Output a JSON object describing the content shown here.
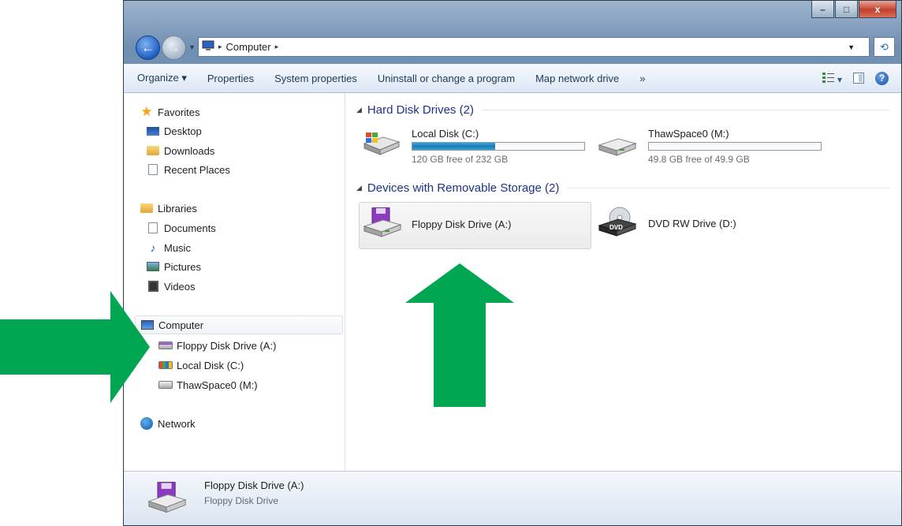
{
  "window": {
    "controls": {
      "minimize": "–",
      "maximize": "□",
      "close": "x"
    }
  },
  "address": {
    "back_icon": "left-arrow",
    "forward_icon": "right-arrow",
    "dropdown_icon": "chevron-down",
    "location_icon": "computer-icon",
    "separator": "▸",
    "path": "Computer",
    "refresh_icon": "refresh-arrows"
  },
  "toolbar": {
    "items": [
      "Organize ▾",
      "Properties",
      "System properties",
      "Uninstall or change a program",
      "Map network drive",
      "»"
    ],
    "views_label": "▾",
    "help_label": "?"
  },
  "nav": {
    "favorites": {
      "label": "Favorites",
      "items": [
        "Desktop",
        "Downloads",
        "Recent Places"
      ]
    },
    "libraries": {
      "label": "Libraries",
      "items": [
        "Documents",
        "Music",
        "Pictures",
        "Videos"
      ]
    },
    "computer": {
      "label": "Computer",
      "items": [
        "Floppy Disk Drive (A:)",
        "Local Disk (C:)",
        "ThawSpace0 (M:)"
      ]
    },
    "network": {
      "label": "Network"
    }
  },
  "main": {
    "groups": [
      {
        "title": "Hard Disk Drives (2)",
        "drives": [
          {
            "name": "Local Disk (C:)",
            "free": "120 GB free of 232 GB",
            "used_fraction": 0.483
          },
          {
            "name": "ThawSpace0 (M:)",
            "free": "49.8 GB free of 49.9 GB",
            "used_fraction": 0.002
          }
        ]
      },
      {
        "title": "Devices with Removable Storage (2)",
        "devices": [
          {
            "name": "Floppy Disk Drive (A:)",
            "selected": true
          },
          {
            "name": "DVD RW Drive (D:)",
            "badge": "DVD"
          }
        ]
      }
    ]
  },
  "details": {
    "name": "Floppy Disk Drive (A:)",
    "type": "Floppy Disk Drive"
  },
  "annotations": {
    "arrow_color": "#00a651"
  },
  "colors": {
    "group_title": "#1e3287",
    "capacity_bar": "#1b7bb8"
  }
}
